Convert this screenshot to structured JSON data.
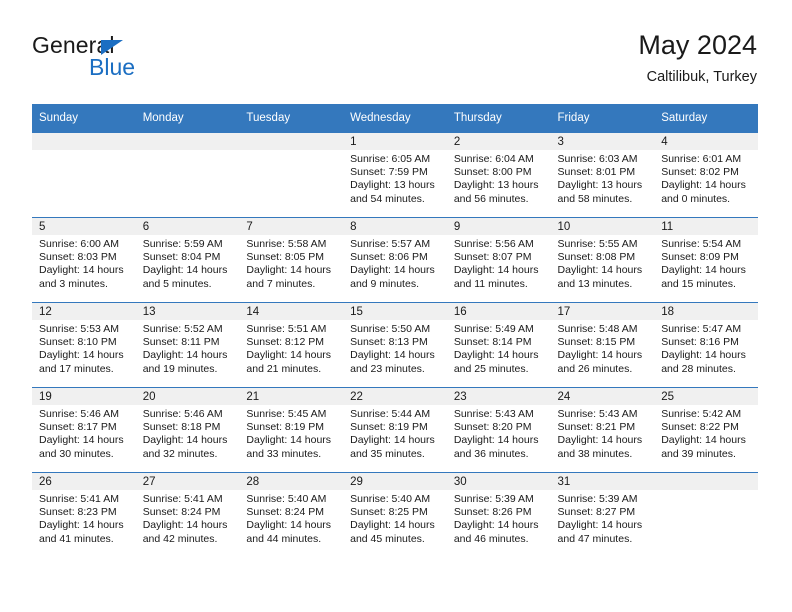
{
  "brand": {
    "name_top": "General",
    "name_bottom": "Blue",
    "accent_color": "#1b6ec2"
  },
  "header": {
    "title": "May 2024",
    "subtitle": "Caltilibuk, Turkey"
  },
  "theme": {
    "header_blue": "#3478bd",
    "daynum_band": "#f0f0f0",
    "text": "#1a1a1a"
  },
  "calendar": {
    "weekday_headers": [
      "Sunday",
      "Monday",
      "Tuesday",
      "Wednesday",
      "Thursday",
      "Friday",
      "Saturday"
    ],
    "weeks": [
      [
        {
          "day": "",
          "sunrise": "",
          "sunset": "",
          "daylight": ""
        },
        {
          "day": "",
          "sunrise": "",
          "sunset": "",
          "daylight": ""
        },
        {
          "day": "",
          "sunrise": "",
          "sunset": "",
          "daylight": ""
        },
        {
          "day": "1",
          "sunrise": "Sunrise: 6:05 AM",
          "sunset": "Sunset: 7:59 PM",
          "daylight": "Daylight: 13 hours and 54 minutes."
        },
        {
          "day": "2",
          "sunrise": "Sunrise: 6:04 AM",
          "sunset": "Sunset: 8:00 PM",
          "daylight": "Daylight: 13 hours and 56 minutes."
        },
        {
          "day": "3",
          "sunrise": "Sunrise: 6:03 AM",
          "sunset": "Sunset: 8:01 PM",
          "daylight": "Daylight: 13 hours and 58 minutes."
        },
        {
          "day": "4",
          "sunrise": "Sunrise: 6:01 AM",
          "sunset": "Sunset: 8:02 PM",
          "daylight": "Daylight: 14 hours and 0 minutes."
        }
      ],
      [
        {
          "day": "5",
          "sunrise": "Sunrise: 6:00 AM",
          "sunset": "Sunset: 8:03 PM",
          "daylight": "Daylight: 14 hours and 3 minutes."
        },
        {
          "day": "6",
          "sunrise": "Sunrise: 5:59 AM",
          "sunset": "Sunset: 8:04 PM",
          "daylight": "Daylight: 14 hours and 5 minutes."
        },
        {
          "day": "7",
          "sunrise": "Sunrise: 5:58 AM",
          "sunset": "Sunset: 8:05 PM",
          "daylight": "Daylight: 14 hours and 7 minutes."
        },
        {
          "day": "8",
          "sunrise": "Sunrise: 5:57 AM",
          "sunset": "Sunset: 8:06 PM",
          "daylight": "Daylight: 14 hours and 9 minutes."
        },
        {
          "day": "9",
          "sunrise": "Sunrise: 5:56 AM",
          "sunset": "Sunset: 8:07 PM",
          "daylight": "Daylight: 14 hours and 11 minutes."
        },
        {
          "day": "10",
          "sunrise": "Sunrise: 5:55 AM",
          "sunset": "Sunset: 8:08 PM",
          "daylight": "Daylight: 14 hours and 13 minutes."
        },
        {
          "day": "11",
          "sunrise": "Sunrise: 5:54 AM",
          "sunset": "Sunset: 8:09 PM",
          "daylight": "Daylight: 14 hours and 15 minutes."
        }
      ],
      [
        {
          "day": "12",
          "sunrise": "Sunrise: 5:53 AM",
          "sunset": "Sunset: 8:10 PM",
          "daylight": "Daylight: 14 hours and 17 minutes."
        },
        {
          "day": "13",
          "sunrise": "Sunrise: 5:52 AM",
          "sunset": "Sunset: 8:11 PM",
          "daylight": "Daylight: 14 hours and 19 minutes."
        },
        {
          "day": "14",
          "sunrise": "Sunrise: 5:51 AM",
          "sunset": "Sunset: 8:12 PM",
          "daylight": "Daylight: 14 hours and 21 minutes."
        },
        {
          "day": "15",
          "sunrise": "Sunrise: 5:50 AM",
          "sunset": "Sunset: 8:13 PM",
          "daylight": "Daylight: 14 hours and 23 minutes."
        },
        {
          "day": "16",
          "sunrise": "Sunrise: 5:49 AM",
          "sunset": "Sunset: 8:14 PM",
          "daylight": "Daylight: 14 hours and 25 minutes."
        },
        {
          "day": "17",
          "sunrise": "Sunrise: 5:48 AM",
          "sunset": "Sunset: 8:15 PM",
          "daylight": "Daylight: 14 hours and 26 minutes."
        },
        {
          "day": "18",
          "sunrise": "Sunrise: 5:47 AM",
          "sunset": "Sunset: 8:16 PM",
          "daylight": "Daylight: 14 hours and 28 minutes."
        }
      ],
      [
        {
          "day": "19",
          "sunrise": "Sunrise: 5:46 AM",
          "sunset": "Sunset: 8:17 PM",
          "daylight": "Daylight: 14 hours and 30 minutes."
        },
        {
          "day": "20",
          "sunrise": "Sunrise: 5:46 AM",
          "sunset": "Sunset: 8:18 PM",
          "daylight": "Daylight: 14 hours and 32 minutes."
        },
        {
          "day": "21",
          "sunrise": "Sunrise: 5:45 AM",
          "sunset": "Sunset: 8:19 PM",
          "daylight": "Daylight: 14 hours and 33 minutes."
        },
        {
          "day": "22",
          "sunrise": "Sunrise: 5:44 AM",
          "sunset": "Sunset: 8:19 PM",
          "daylight": "Daylight: 14 hours and 35 minutes."
        },
        {
          "day": "23",
          "sunrise": "Sunrise: 5:43 AM",
          "sunset": "Sunset: 8:20 PM",
          "daylight": "Daylight: 14 hours and 36 minutes."
        },
        {
          "day": "24",
          "sunrise": "Sunrise: 5:43 AM",
          "sunset": "Sunset: 8:21 PM",
          "daylight": "Daylight: 14 hours and 38 minutes."
        },
        {
          "day": "25",
          "sunrise": "Sunrise: 5:42 AM",
          "sunset": "Sunset: 8:22 PM",
          "daylight": "Daylight: 14 hours and 39 minutes."
        }
      ],
      [
        {
          "day": "26",
          "sunrise": "Sunrise: 5:41 AM",
          "sunset": "Sunset: 8:23 PM",
          "daylight": "Daylight: 14 hours and 41 minutes."
        },
        {
          "day": "27",
          "sunrise": "Sunrise: 5:41 AM",
          "sunset": "Sunset: 8:24 PM",
          "daylight": "Daylight: 14 hours and 42 minutes."
        },
        {
          "day": "28",
          "sunrise": "Sunrise: 5:40 AM",
          "sunset": "Sunset: 8:24 PM",
          "daylight": "Daylight: 14 hours and 44 minutes."
        },
        {
          "day": "29",
          "sunrise": "Sunrise: 5:40 AM",
          "sunset": "Sunset: 8:25 PM",
          "daylight": "Daylight: 14 hours and 45 minutes."
        },
        {
          "day": "30",
          "sunrise": "Sunrise: 5:39 AM",
          "sunset": "Sunset: 8:26 PM",
          "daylight": "Daylight: 14 hours and 46 minutes."
        },
        {
          "day": "31",
          "sunrise": "Sunrise: 5:39 AM",
          "sunset": "Sunset: 8:27 PM",
          "daylight": "Daylight: 14 hours and 47 minutes."
        },
        {
          "day": "",
          "sunrise": "",
          "sunset": "",
          "daylight": ""
        }
      ]
    ]
  }
}
